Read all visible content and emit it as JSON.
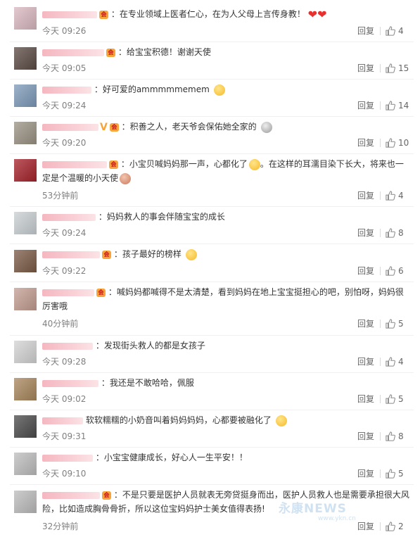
{
  "ui": {
    "reply_label": "回复"
  },
  "comments": [
    {
      "text": "：在专业领域上医者仁心，在为人父母上言传身教！",
      "time": "今天 09:26",
      "likes": "4"
    },
    {
      "text": "：给宝宝积德！谢谢天使",
      "time": "今天 09:05",
      "likes": "15"
    },
    {
      "text": "：好可爱的ammmmmemem",
      "time": "今天 09:24",
      "likes": "14"
    },
    {
      "text": "：积善之人，老天爷会保佑她全家的",
      "time": "今天 09:20",
      "likes": "10"
    },
    {
      "text": "：小宝贝喊妈妈那一声，心都化了",
      "text2": "。在这样的耳濡目染下长大，将来也一定是个温暖的小天使",
      "time": "53分钟前",
      "likes": "4"
    },
    {
      "text": "：妈妈救人的事会伴随宝宝的成长",
      "time": "今天 09:24",
      "likes": "8"
    },
    {
      "text": "：孩子最好的榜样",
      "time": "今天 09:22",
      "likes": "6"
    },
    {
      "text": "：喊妈妈都喊得不是太清楚，看到妈妈在地上宝宝挺担心的吧，别怕呀，妈妈很厉害哦",
      "time": "40分钟前",
      "likes": "5"
    },
    {
      "text": "：发现街头救人的都是女孩子",
      "time": "今天 09:28",
      "likes": "4"
    },
    {
      "text": "：我还是不敢哈哈，佩服",
      "time": "今天 09:02",
      "likes": "5"
    },
    {
      "text": "软软糯糯的小奶音叫着妈妈妈妈，心都要被融化了",
      "time": "今天 09:31",
      "likes": "8"
    },
    {
      "text": "：小宝宝健康成长，好心人一生平安！！",
      "time": "今天 09:10",
      "likes": "5"
    },
    {
      "text": "：不是只要是医护人员就表无旁贷挺身而出，医护人员救人也是需要承担很大风险，比如造成胸骨骨折，所以这位宝妈妈护士美女值得表扬!",
      "time": "32分钟前",
      "likes": "2"
    }
  ],
  "watermark": {
    "text": "永康NEWS",
    "url": "www.ykn.cn"
  },
  "colors": {
    "username_blur": "#f5b7c0",
    "badge": "#f7a43a",
    "heart": "#e8302f",
    "muted_text": "#808080"
  }
}
